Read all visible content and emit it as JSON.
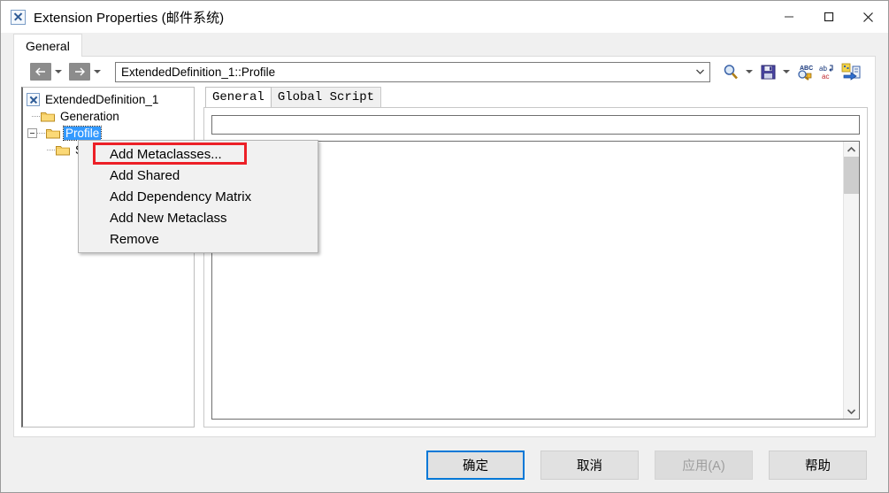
{
  "window": {
    "title": "Extension Properties (邮件系统)",
    "icon": "extension-document-icon",
    "controls": {
      "minimize": "minimize-icon",
      "maximize": "maximize-icon",
      "close": "close-icon"
    }
  },
  "outer_tabs": [
    {
      "label": "General",
      "active": true
    }
  ],
  "toolbar": {
    "back": {
      "icon": "arrow-left-icon"
    },
    "back_dropdown": {
      "icon": "chevron-down-icon"
    },
    "forward": {
      "icon": "arrow-right-icon"
    },
    "forward_dropdown": {
      "icon": "chevron-down-icon"
    },
    "path": {
      "value": "ExtendedDefinition_1::Profile",
      "dropdown_icon": "chevron-down-icon"
    },
    "icons": [
      {
        "name": "search-icon",
        "tooltip": "Find"
      },
      {
        "name": "chevron-down-icon",
        "tooltip": "Find options"
      },
      {
        "name": "save-icon",
        "tooltip": "Save"
      },
      {
        "name": "chevron-down-icon",
        "tooltip": "Save options"
      },
      {
        "name": "spell-check-icon",
        "tooltip": "Spelling"
      },
      {
        "name": "replace-icon",
        "tooltip": "Replace"
      },
      {
        "name": "export-icon",
        "tooltip": "Export"
      }
    ]
  },
  "tree": {
    "nodes": [
      {
        "label": "ExtendedDefinition_1",
        "icon": "extension-document-icon",
        "level": 0,
        "expander": "none",
        "selected": false
      },
      {
        "label": "Generation",
        "icon": "folder-icon",
        "level": 1,
        "expander": "none",
        "selected": false
      },
      {
        "label": "Profile",
        "icon": "folder-icon",
        "level": 1,
        "expander": "minus",
        "selected": true
      },
      {
        "label": "S",
        "icon": "folder-icon",
        "level": 2,
        "expander": "none",
        "selected": false
      }
    ]
  },
  "inner_tabs": [
    {
      "label": "General",
      "active": true
    },
    {
      "label": "Global Script",
      "active": false
    }
  ],
  "editor": {
    "name_value": "",
    "body_value": "",
    "scrollbar": {
      "up_icon": "chevron-up-icon",
      "down_icon": "chevron-down-icon"
    }
  },
  "context_menu": {
    "items": [
      {
        "label": "Add Metaclasses...",
        "highlighted": true
      },
      {
        "label": "Add Shared",
        "highlighted": false
      },
      {
        "label": "Add Dependency Matrix",
        "highlighted": false
      },
      {
        "label": "Add New Metaclass",
        "highlighted": false
      },
      {
        "label": "Remove",
        "highlighted": false
      }
    ]
  },
  "annotation": {
    "color": "#ec2027",
    "target": "Add Metaclasses..."
  },
  "footer": {
    "buttons": [
      {
        "label": "确定",
        "state": "default"
      },
      {
        "label": "取消",
        "state": "normal"
      },
      {
        "label": "应用(A)",
        "state": "disabled",
        "mnemonic": "A"
      },
      {
        "label": "帮助",
        "state": "normal"
      }
    ]
  }
}
